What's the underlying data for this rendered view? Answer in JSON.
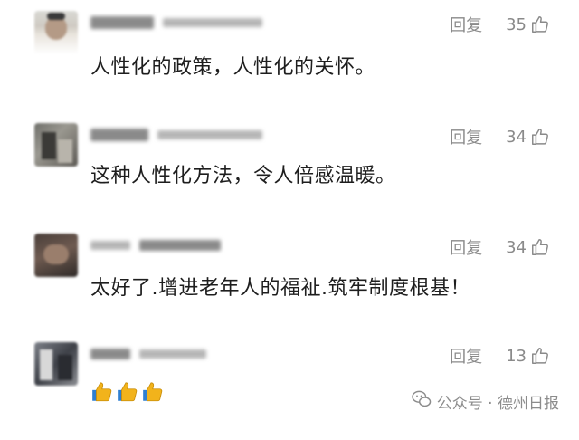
{
  "comments": [
    {
      "reply_label": "回复",
      "likes": "35",
      "text": "人性化的政策，人性化的关怀。"
    },
    {
      "reply_label": "回复",
      "likes": "34",
      "text": "这种人性化方法，令人倍感温暖。"
    },
    {
      "reply_label": "回复",
      "likes": "34",
      "text": "太好了.增进老年人的福祉.筑牢制度根基！"
    },
    {
      "reply_label": "回复",
      "likes": "13",
      "emoji": [
        "thumbs-up",
        "thumbs-up",
        "thumbs-up"
      ]
    }
  ],
  "watermark": {
    "source": "公众号 · 德州日报",
    "icon": "wechat-icon"
  },
  "colors": {
    "text": "#1e1e1e",
    "meta": "#8a8a8a",
    "emoji": "#f2b31b"
  }
}
